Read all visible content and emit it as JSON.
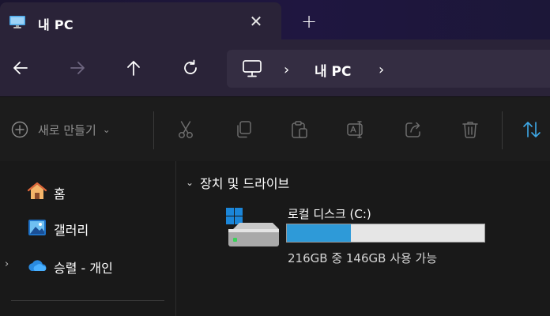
{
  "tab": {
    "title": "내 PC",
    "close_glyph": "✕",
    "new_tab_glyph": "+"
  },
  "nav": {
    "back": "arrow-left-icon",
    "forward": "arrow-right-icon",
    "up": "arrow-up-icon",
    "refresh": "refresh-icon",
    "address": {
      "chevron_glyph": "›",
      "location_label": "내 PC"
    }
  },
  "command_bar": {
    "new_label": "새로 만들기",
    "new_chevron": "⌄",
    "icons": [
      "cut-icon",
      "copy-icon",
      "paste-icon",
      "rename-icon",
      "share-icon",
      "delete-icon",
      "sort-icon"
    ]
  },
  "sidebar": {
    "items": [
      {
        "label": "홈",
        "icon": "home-icon"
      },
      {
        "label": "갤러리",
        "icon": "gallery-icon"
      },
      {
        "label": "승렬 - 개인",
        "icon": "onedrive-icon",
        "expand_glyph": "›"
      }
    ]
  },
  "content": {
    "section_chevron": "⌄",
    "section_label": "장치 및 드라이브",
    "drives": [
      {
        "name": "로컬 디스크 (C:)",
        "space_text": "216GB 중 146GB 사용 가능",
        "used_fraction": 0.324
      }
    ]
  },
  "colors": {
    "accent": "#2e9ad8",
    "nav_background": "#2a2338",
    "title_background": "#1b1530",
    "body_background": "#191919"
  }
}
